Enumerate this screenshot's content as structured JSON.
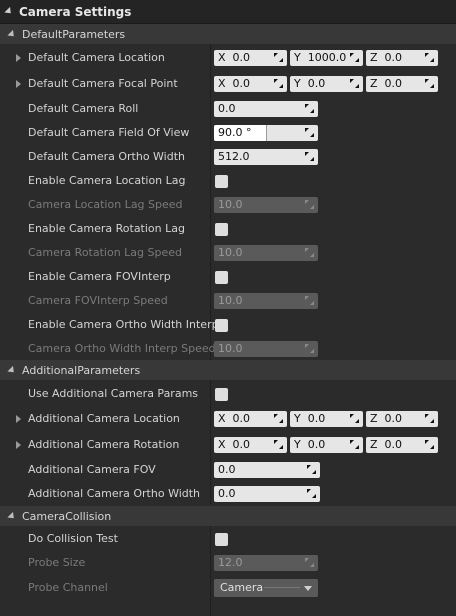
{
  "panel": {
    "title": "Camera Settings"
  },
  "categories": {
    "default": "DefaultParameters",
    "additional": "AdditionalParameters",
    "collision": "CameraCollision"
  },
  "props": {
    "cam_location": {
      "label": "Default Camera Location",
      "x": "0.0",
      "y": "1000.0",
      "z": "0.0"
    },
    "cam_focal": {
      "label": "Default Camera Focal Point",
      "x": "0.0",
      "y": "0.0",
      "z": "0.0"
    },
    "cam_roll": {
      "label": "Default Camera Roll",
      "value": "0.0"
    },
    "cam_fov": {
      "label": "Default Camera Field Of View",
      "value": "90.0 °",
      "fill_fraction": 0.5
    },
    "cam_ortho": {
      "label": "Default Camera Ortho Width",
      "value": "512.0"
    },
    "loc_lag": {
      "label": "Enable Camera Location Lag"
    },
    "loc_lag_speed": {
      "label": "Camera Location Lag Speed",
      "value": "10.0"
    },
    "rot_lag": {
      "label": "Enable Camera Rotation Lag"
    },
    "rot_lag_speed": {
      "label": "Camera Rotation Lag Speed",
      "value": "10.0"
    },
    "fov_interp": {
      "label": "Enable Camera FOVInterp"
    },
    "fov_interp_speed": {
      "label": "Camera FOVInterp Speed",
      "value": "10.0"
    },
    "ortho_interp": {
      "label": "Enable Camera Ortho Width Interp"
    },
    "ortho_interp_speed": {
      "label": "Camera Ortho Width Interp Speed",
      "value": "10.0"
    },
    "use_additional": {
      "label": "Use Additional Camera Params"
    },
    "add_location": {
      "label": "Additional Camera Location",
      "x": "0.0",
      "y": "0.0",
      "z": "0.0"
    },
    "add_rotation": {
      "label": "Additional Camera Rotation",
      "x": "0.0",
      "y": "0.0",
      "z": "0.0"
    },
    "add_fov": {
      "label": "Additional Camera FOV",
      "value": "0.0"
    },
    "add_ortho": {
      "label": "Additional Camera Ortho Width",
      "value": "0.0"
    },
    "collision_test": {
      "label": "Do Collision Test"
    },
    "probe_size": {
      "label": "Probe Size",
      "value": "12.0"
    },
    "probe_channel": {
      "label": "Probe Channel",
      "value": "Camera"
    }
  },
  "axis": {
    "x": "X",
    "y": "Y",
    "z": "Z"
  },
  "colors": {
    "panel_bg": "#2b2b2b",
    "category_bg": "#383838",
    "field_bg": "#e6e6e6",
    "field_disabled_bg": "#5a5a5a"
  },
  "icons": {
    "category_toggle": "triangle-down-icon",
    "row_expander": "triangle-right-icon",
    "spin_grip": "diagonal-arrows-icon",
    "dropdown": "chevron-down-icon"
  }
}
